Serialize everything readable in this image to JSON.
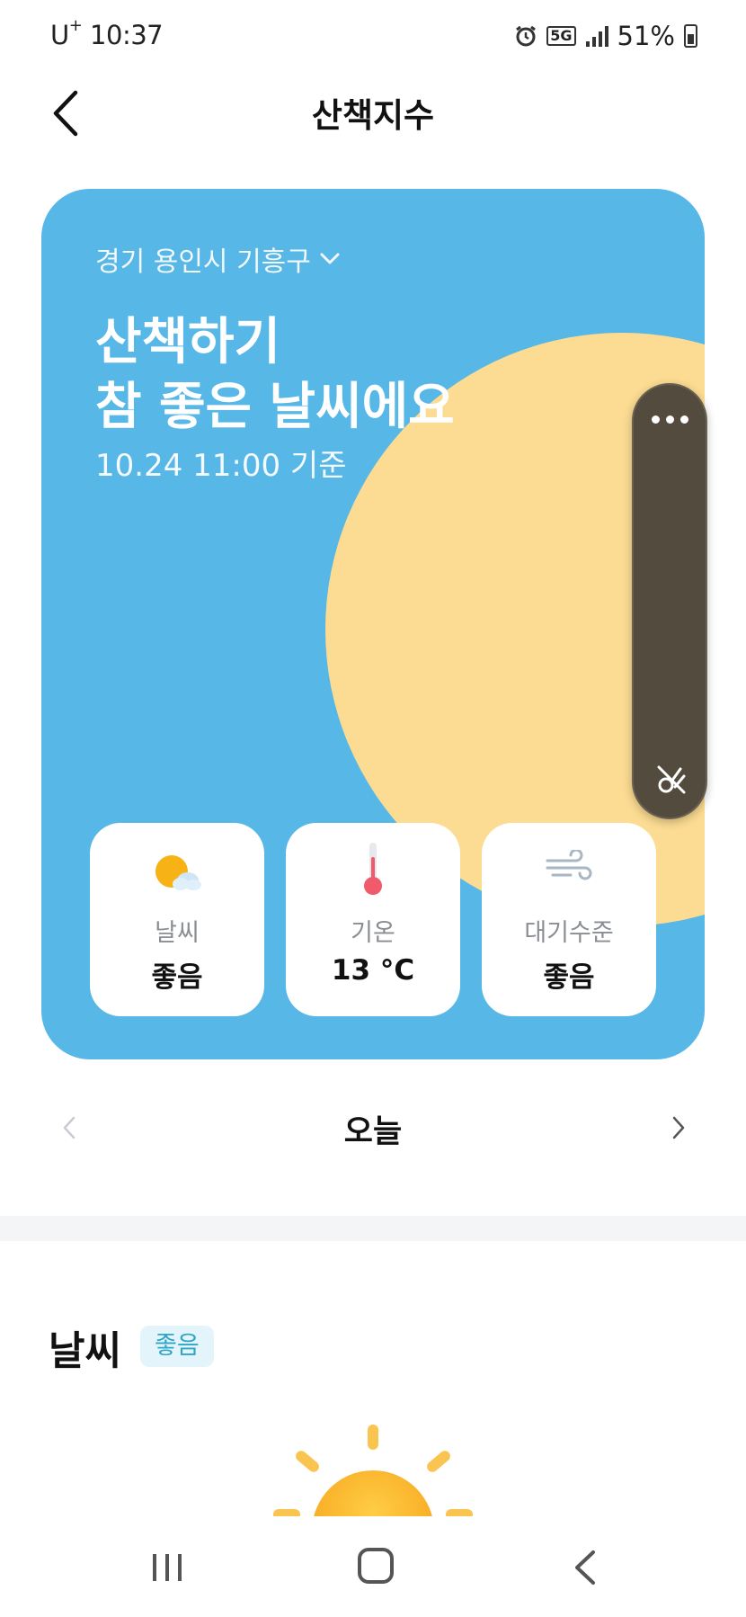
{
  "status_bar": {
    "carrier": "U",
    "carrier_sup": "+",
    "time": "10:37",
    "network": "5G",
    "battery": "51%"
  },
  "header": {
    "title": "산책지수",
    "back_icon": "chevron-left-icon"
  },
  "hero": {
    "location": "경기 용인시 기흥구",
    "headline_line1": "산책하기",
    "headline_line2": "참 좋은 날씨에요",
    "timestamp": "10.24 11:00 기준",
    "background_color": "#57b7e6",
    "sun_color": "#fcdc92",
    "metrics": [
      {
        "icon": "sun-cloud-icon",
        "label": "날씨",
        "value": "좋음"
      },
      {
        "icon": "thermometer-icon",
        "label": "기온",
        "value": "13 °C"
      },
      {
        "icon": "wind-icon",
        "label": "대기수준",
        "value": "좋음"
      }
    ]
  },
  "floating_panel": {
    "more_icon": "more-dots-icon",
    "hide_icon": "hide-panel-icon"
  },
  "day_nav": {
    "label": "오늘"
  },
  "weather_section": {
    "title": "날씨",
    "badge": "좋음",
    "badge_color": "#2fa6c8"
  },
  "nav_bar": {
    "items": [
      "recent-apps-icon",
      "home-icon",
      "back-icon"
    ]
  }
}
